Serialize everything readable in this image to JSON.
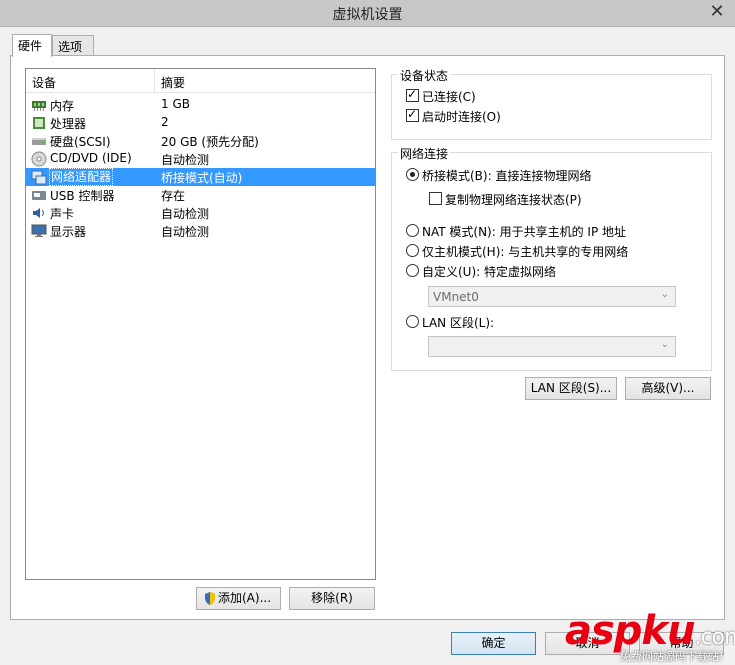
{
  "window": {
    "title": "虚拟机设置",
    "close": "✕"
  },
  "tabs": [
    {
      "label": "硬件"
    },
    {
      "label": "选项"
    }
  ],
  "devices": {
    "headers": {
      "device": "设备",
      "summary": "摘要"
    },
    "rows": [
      {
        "icon": "memory-icon",
        "name": "内存",
        "summary": "1 GB"
      },
      {
        "icon": "processor-icon",
        "name": "处理器",
        "summary": "2"
      },
      {
        "icon": "harddisk-icon",
        "name": "硬盘(SCSI)",
        "summary": "20 GB (预先分配)"
      },
      {
        "icon": "cdrom-icon",
        "name": "CD/DVD (IDE)",
        "summary": "自动检测"
      },
      {
        "icon": "network-adapter-icon",
        "name": "网络适配器",
        "summary": "桥接模式(自动)"
      },
      {
        "icon": "usb-icon",
        "name": "USB 控制器",
        "summary": "存在"
      },
      {
        "icon": "sound-icon",
        "name": "声卡",
        "summary": "自动检测"
      },
      {
        "icon": "display-icon",
        "name": "显示器",
        "summary": "自动检测"
      }
    ],
    "selected_index": 4,
    "add_label": "添加(A)...",
    "remove_label": "移除(R)"
  },
  "device_status": {
    "title": "设备状态",
    "connected": {
      "label": "已连接(C)",
      "checked": true
    },
    "connect_at_power_on": {
      "label": "启动时连接(O)",
      "checked": true
    }
  },
  "network": {
    "title": "网络连接",
    "bridged": {
      "label": "桥接模式(B): 直接连接物理网络",
      "selected": true
    },
    "replicate": {
      "label": "复制物理网络连接状态(P)",
      "checked": false
    },
    "nat": {
      "label": "NAT 模式(N): 用于共享主机的 IP 地址",
      "selected": false
    },
    "host_only": {
      "label": "仅主机模式(H): 与主机共享的专用网络",
      "selected": false
    },
    "custom": {
      "label": "自定义(U): 特定虚拟网络",
      "selected": false,
      "value": "VMnet0"
    },
    "lan_segment": {
      "label": "LAN 区段(L):",
      "selected": false,
      "value": ""
    }
  },
  "buttons": {
    "lan_segments": "LAN 区段(S)...",
    "advanced": "高级(V)...",
    "ok": "确定",
    "cancel": "取消",
    "help": "帮助"
  },
  "watermark": {
    "brand": "aspku",
    "suffix": ".com",
    "tagline": "免费网站源码下载站!"
  },
  "colors": {
    "selection": "#3399ff",
    "watermark_red": "#e60012"
  }
}
